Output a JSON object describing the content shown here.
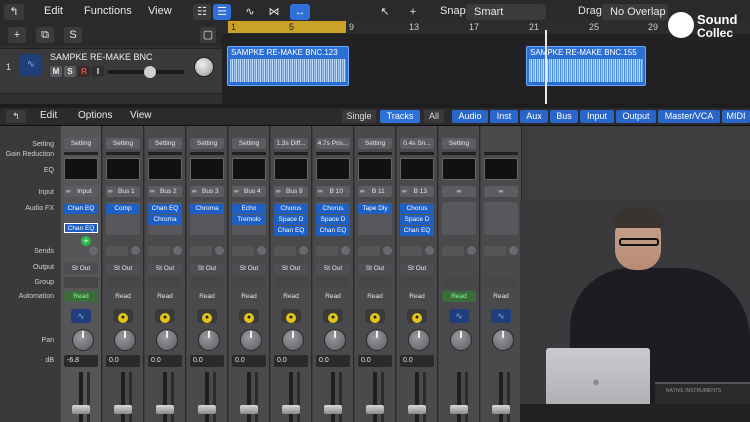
{
  "topbar": {
    "edit": "Edit",
    "functions": "Functions",
    "view": "View",
    "snap_label": "Snap:",
    "snap_value": "Smart",
    "drag_label": "Drag:",
    "drag_value": "No Overlap"
  },
  "ruler": {
    "marks": [
      "1",
      "5",
      "9",
      "13",
      "17",
      "21",
      "25",
      "29"
    ]
  },
  "track": {
    "number": "1",
    "name": "SAMPKE RE-MAKE BNC",
    "mute": "M",
    "solo": "S",
    "record": "R",
    "input": "I"
  },
  "regions": [
    {
      "name": "SAMPKE RE-MAKE BNC.123"
    },
    {
      "name": "SAMPKE RE-MAKE BNC.155"
    }
  ],
  "mixer_bar": {
    "edit": "Edit",
    "options": "Options",
    "view": "View",
    "modes": [
      "Single",
      "Tracks",
      "All"
    ],
    "filters": [
      "Audio",
      "Inst",
      "Aux",
      "Bus",
      "Input",
      "Output",
      "Master/VCA",
      "MIDI"
    ]
  },
  "row_labels": {
    "setting": "Setting",
    "gain_reduction": "Gain Reduction",
    "eq": "EQ",
    "input": "Input",
    "audio_fx": "Audio FX",
    "sends": "Sends",
    "output": "Output",
    "group": "Group",
    "automation": "Automation",
    "pan": "Pan",
    "db": "dB"
  },
  "strips": [
    {
      "setting": "Setting",
      "input": "Input",
      "fx": [
        "Chan EQ"
      ],
      "fx_drag": "Chan EQ",
      "output": "St Out",
      "automation": "Read",
      "auto_green": true,
      "db": "-6.8",
      "icon": "waveform"
    },
    {
      "setting": "Setting",
      "input": "Bus 1",
      "fx": [
        "Comp"
      ],
      "output": "St Out",
      "automation": "Read",
      "auto_green": false,
      "db": "0.0",
      "icon": "aux"
    },
    {
      "setting": "Setting",
      "input": "Bus 2",
      "fx": [
        "Chan EQ",
        "Chroma"
      ],
      "output": "St Out",
      "automation": "Read",
      "auto_green": false,
      "db": "0.0",
      "icon": "aux"
    },
    {
      "setting": "Setting",
      "input": "Bus 3",
      "fx": [
        "Chroma"
      ],
      "output": "St Out",
      "automation": "Read",
      "auto_green": false,
      "db": "0.0",
      "icon": "aux"
    },
    {
      "setting": "Setting",
      "input": "Bus 4",
      "fx": [
        "Echo",
        "Tremolo"
      ],
      "output": "St Out",
      "automation": "Read",
      "auto_green": false,
      "db": "0.0",
      "icon": "aux"
    },
    {
      "setting": "1.3s Diff...",
      "input": "Bus 9",
      "fx": [
        "Chorus",
        "Space D",
        "Chan EQ"
      ],
      "output": "St Out",
      "automation": "Read",
      "auto_green": false,
      "db": "0.0",
      "icon": "aux"
    },
    {
      "setting": "4.7s Pris...",
      "input": "B 10",
      "fx": [
        "Chorus",
        "Space D",
        "Chan EQ"
      ],
      "output": "St Out",
      "automation": "Read",
      "auto_green": false,
      "db": "0.0",
      "icon": "aux"
    },
    {
      "setting": "Setting",
      "input": "B 11",
      "fx": [
        "Tape Dly"
      ],
      "output": "St Out",
      "automation": "Read",
      "auto_green": false,
      "db": "0.0",
      "icon": "aux"
    },
    {
      "setting": "0.4s Sn...",
      "input": "B 13",
      "fx": [
        "Chorus",
        "Space D",
        "Chan EQ"
      ],
      "output": "St Out",
      "automation": "Read",
      "auto_green": false,
      "db": "0.0",
      "icon": "aux"
    },
    {
      "setting": "Setting",
      "input": "",
      "fx": [],
      "output": "",
      "automation": "Read",
      "auto_green": true,
      "db": "",
      "icon": "waveform"
    },
    {
      "setting": "",
      "input": "",
      "fx": [],
      "output": "",
      "automation": "Read",
      "auto_green": false,
      "db": "",
      "icon": "waveform"
    }
  ],
  "watermark": {
    "line1": "Sound",
    "line2": "Collec"
  },
  "hardware": {
    "synth_label": "NATIVE INSTRUMENTS"
  }
}
